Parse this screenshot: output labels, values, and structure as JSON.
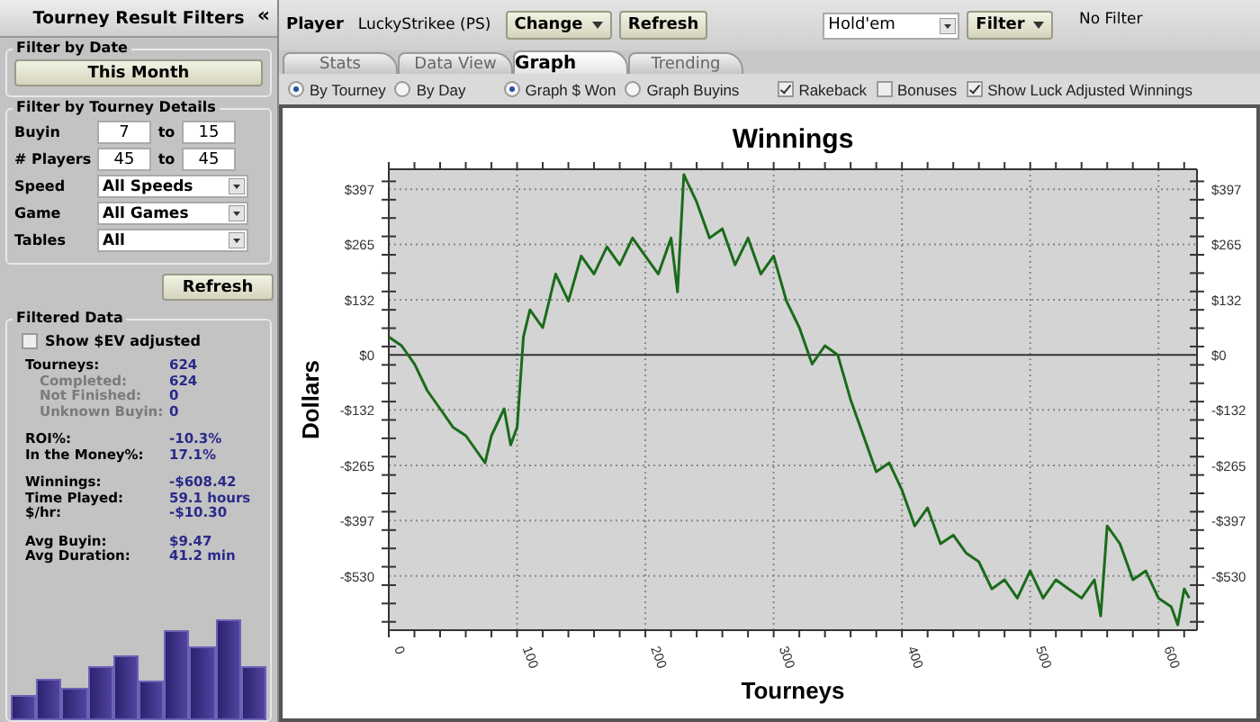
{
  "sidebar": {
    "title": "Tourney Result Filters",
    "collapse": "«",
    "date_group": {
      "legend": "Filter by Date",
      "button": "This Month"
    },
    "details_group": {
      "legend": "Filter by Tourney Details",
      "ranges": [
        {
          "label": "Buyin",
          "from": "7",
          "joiner": "to",
          "to": "15"
        },
        {
          "label": "# Players",
          "from": "45",
          "joiner": "to",
          "to": "45"
        }
      ],
      "selects": [
        {
          "label": "Speed",
          "value": "All Speeds"
        },
        {
          "label": "Game",
          "value": "All Games"
        },
        {
          "label": "Tables",
          "value": "All"
        }
      ]
    },
    "refresh": "Refresh",
    "filtered": {
      "legend": "Filtered Data",
      "ev_checkbox": {
        "label": "Show $EV adjusted",
        "checked": false
      },
      "groups": [
        [
          {
            "label": "Tourneys:",
            "value": "624",
            "kind": "main"
          },
          {
            "label": "Completed:",
            "value": "624",
            "kind": "sub"
          },
          {
            "label": "Not Finished:",
            "value": "0",
            "kind": "sub"
          },
          {
            "label": "Unknown Buyin:",
            "value": "0",
            "kind": "sub"
          }
        ],
        [
          {
            "label": "ROI%:",
            "value": "-10.3%",
            "kind": "main"
          },
          {
            "label": "In the Money%:",
            "value": "17.1%",
            "kind": "main"
          }
        ],
        [
          {
            "label": "Winnings:",
            "value": "-$608.42",
            "kind": "main"
          },
          {
            "label": "Time Played:",
            "value": "59.1 hours",
            "kind": "main"
          },
          {
            "label": "$/hr:",
            "value": "-$10.30",
            "kind": "main"
          }
        ],
        [
          {
            "label": "Avg Buyin:",
            "value": "$9.47",
            "kind": "main"
          },
          {
            "label": "Avg Duration:",
            "value": "41.2 min",
            "kind": "main"
          }
        ]
      ]
    }
  },
  "toolbar": {
    "player_label": "Player",
    "player": "LuckyStrikee (PS)",
    "change": "Change",
    "refresh": "Refresh",
    "game": "Hold'em",
    "filter": "Filter",
    "filter_status": "No Filter"
  },
  "tabs": [
    {
      "label": "Stats",
      "selected": false
    },
    {
      "label": "Data View",
      "selected": false
    },
    {
      "label": "Graph",
      "selected": true
    },
    {
      "label": "Trending",
      "selected": false
    }
  ],
  "options": [
    {
      "kind": "radio",
      "label": "By Tourney",
      "selected": true
    },
    {
      "kind": "radio",
      "label": "By Day",
      "selected": false
    },
    {
      "kind": "radio",
      "label": "Graph $ Won",
      "selected": true
    },
    {
      "kind": "radio",
      "label": "Graph Buyins",
      "selected": false
    },
    {
      "kind": "checkbox",
      "label": "Rakeback",
      "checked": true
    },
    {
      "kind": "checkbox",
      "label": "Bonuses",
      "checked": false
    },
    {
      "kind": "checkbox",
      "label": "Show Luck Adjusted Winnings",
      "checked": true
    }
  ],
  "graph": {
    "chart_data": {
      "type": "line",
      "title": "Winnings",
      "xlabel": "Tourneys",
      "ylabel": "Dollars",
      "x": [
        0,
        10,
        20,
        30,
        40,
        50,
        60,
        70,
        75,
        80,
        90,
        95,
        100,
        105,
        110,
        120,
        130,
        140,
        150,
        160,
        170,
        180,
        190,
        200,
        210,
        220,
        225,
        230,
        240,
        250,
        260,
        270,
        280,
        290,
        300,
        310,
        320,
        330,
        340,
        350,
        360,
        370,
        380,
        390,
        400,
        410,
        420,
        430,
        440,
        450,
        460,
        470,
        480,
        490,
        500,
        510,
        520,
        530,
        540,
        550,
        555,
        560,
        570,
        580,
        590,
        600,
        610,
        615,
        620,
        624
      ],
      "grid": true,
      "series": [
        {
          "color": "#1a6b1a",
          "values": [
            43,
            22,
            -22,
            -86,
            -129,
            -173,
            -194,
            -237,
            -259,
            -194,
            -129,
            -216,
            -173,
            43,
            108,
            65,
            194,
            129,
            237,
            194,
            259,
            216,
            280,
            237,
            194,
            280,
            151,
            432,
            367,
            280,
            302,
            216,
            280,
            194,
            237,
            129,
            65,
            -22,
            22,
            0,
            -108,
            -194,
            -280,
            -259,
            -324,
            -410,
            -367,
            -453,
            -432,
            -475,
            -496,
            -561,
            -539,
            -583,
            -518,
            -583,
            -539,
            -561,
            -583,
            -539,
            -626,
            -410,
            -453,
            -539,
            -518,
            -583,
            -604,
            -647,
            -561,
            -583
          ]
        }
      ],
      "xlim": [
        0,
        630
      ],
      "ylim": [
        -660,
        445
      ],
      "xticks": [
        0,
        100,
        200,
        300,
        400,
        500,
        600
      ],
      "yticks": [
        {
          "value": 397,
          "label": "$397"
        },
        {
          "value": 265,
          "label": "$265"
        },
        {
          "value": 132,
          "label": "$132"
        },
        {
          "value": 0,
          "label": "$0"
        },
        {
          "value": -132,
          "label": "-$132"
        },
        {
          "value": -265,
          "label": "-$265"
        },
        {
          "value": -397,
          "label": "-$397"
        },
        {
          "value": -530,
          "label": "-$530"
        }
      ]
    }
  }
}
